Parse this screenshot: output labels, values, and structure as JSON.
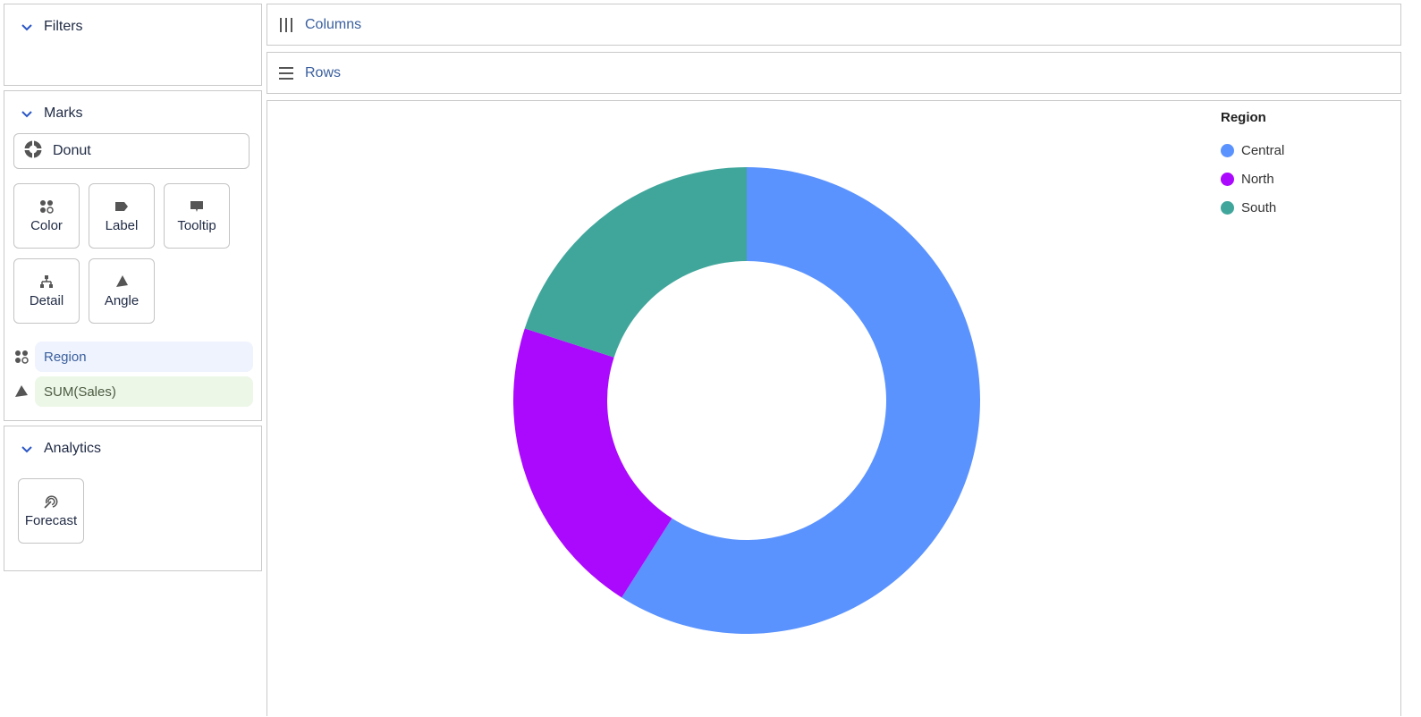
{
  "filters": {
    "title": "Filters"
  },
  "marks": {
    "title": "Marks",
    "mark_type": "Donut",
    "buttons": {
      "color": "Color",
      "label": "Label",
      "tooltip": "Tooltip",
      "detail": "Detail",
      "angle": "Angle"
    },
    "color_field": "Region",
    "angle_field": "SUM(Sales)"
  },
  "analytics": {
    "title": "Analytics",
    "forecast": "Forecast"
  },
  "shelves": {
    "columns": "Columns",
    "rows": "Rows"
  },
  "colors": {
    "accent": "#3a5f9e",
    "chevron": "#2a56c6",
    "icon": "#555555"
  },
  "chart_data": {
    "type": "pie",
    "donut": true,
    "legend_title": "Region",
    "legend_position": "top-right",
    "categories": [
      "Central",
      "North",
      "South"
    ],
    "values": [
      59,
      21,
      20
    ],
    "colors": [
      "#5b93fe",
      "#ab08fe",
      "#40a69b"
    ]
  }
}
